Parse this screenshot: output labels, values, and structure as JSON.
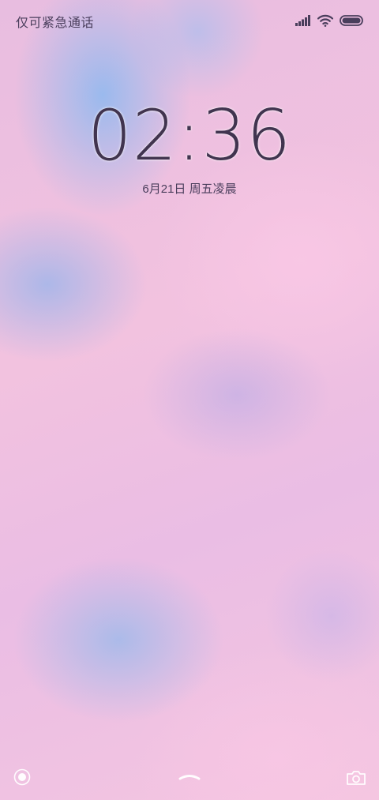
{
  "status_bar": {
    "carrier": "仅可紧急通话",
    "icons": [
      "signal-icon",
      "wifi-icon",
      "battery-icon"
    ]
  },
  "lock_screen": {
    "time": "02:36",
    "date": "6月21日 周五凌晨"
  },
  "bottom_bar": {
    "left_icon": "assistant-icon",
    "center_icon": "unlock-handle-icon",
    "right_icon": "camera-icon"
  },
  "colors": {
    "text_dark": "#41344f",
    "wallpaper_pink": "#f2c2df",
    "wallpaper_blue": "#8cb9f0"
  }
}
